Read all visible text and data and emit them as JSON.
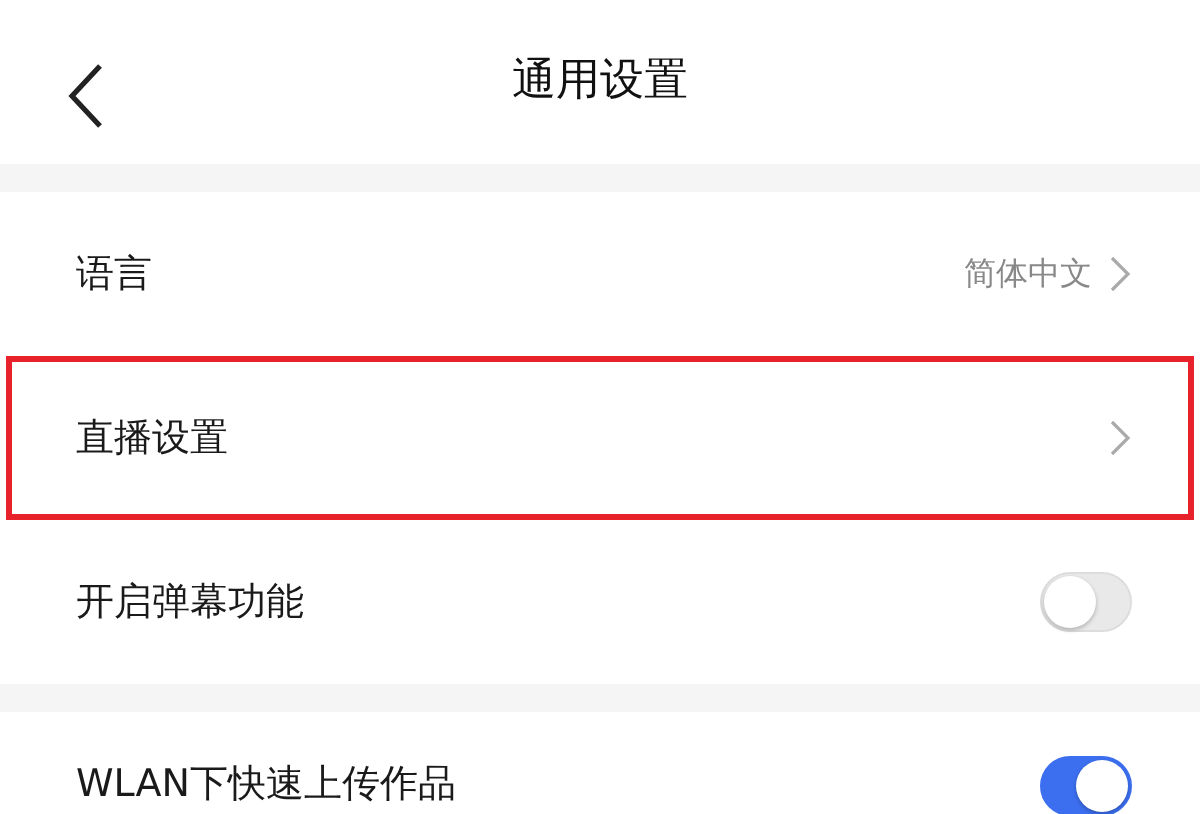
{
  "header": {
    "title": "通用设置"
  },
  "groups": [
    {
      "items": [
        {
          "kind": "value",
          "label": "语言",
          "value": "简体中文",
          "highlighted": false
        },
        {
          "kind": "link",
          "label": "直播设置",
          "highlighted": true
        },
        {
          "kind": "toggle",
          "label": "开启弹幕功能",
          "on": false,
          "highlighted": false
        }
      ]
    },
    {
      "items": [
        {
          "kind": "toggle",
          "label": "WLAN下快速上传作品",
          "on": true,
          "highlighted": false
        }
      ]
    }
  ]
}
